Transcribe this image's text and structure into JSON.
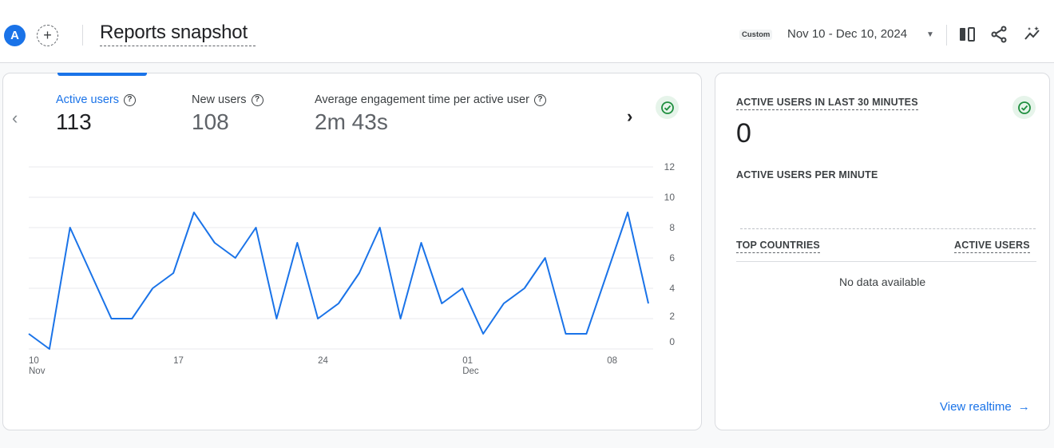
{
  "header": {
    "avatar_letter": "A",
    "add_symbol": "+",
    "title": "Reports snapshot",
    "date_chip": "Custom",
    "date_range": "Nov 10 - Dec 10, 2024",
    "date_caret": "▼",
    "icons": [
      "compare-icon",
      "share-icon",
      "insights-icon"
    ]
  },
  "metrics": [
    {
      "label": "Active users",
      "value": "113",
      "active": true
    },
    {
      "label": "New users",
      "value": "108",
      "active": false
    },
    {
      "label": "Average engagement time per active user",
      "value": "2m 43s",
      "active": false
    }
  ],
  "help_symbol": "?",
  "nav": {
    "prev": "‹",
    "next": "›"
  },
  "chart_data": {
    "type": "line",
    "title": "",
    "x": [
      "Nov 10",
      "Nov 11",
      "Nov 12",
      "Nov 13",
      "Nov 14",
      "Nov 15",
      "Nov 16",
      "Nov 17",
      "Nov 18",
      "Nov 19",
      "Nov 20",
      "Nov 21",
      "Nov 22",
      "Nov 23",
      "Nov 24",
      "Nov 25",
      "Nov 26",
      "Nov 27",
      "Nov 28",
      "Nov 29",
      "Nov 30",
      "Dec 01",
      "Dec 02",
      "Dec 03",
      "Dec 04",
      "Dec 05",
      "Dec 06",
      "Dec 07",
      "Dec 08",
      "Dec 09",
      "Dec 10"
    ],
    "series": [
      {
        "name": "Active users",
        "values": [
          1,
          0,
          8,
          5,
          2,
          2,
          4,
          5,
          9,
          7,
          6,
          8,
          2,
          7,
          2,
          3,
          5,
          8,
          2,
          7,
          3,
          4,
          1,
          3,
          4,
          6,
          1,
          1,
          5,
          9,
          3
        ]
      }
    ],
    "x_ticks": [
      {
        "day": "10",
        "month": "Nov"
      },
      {
        "day": "17",
        "month": ""
      },
      {
        "day": "24",
        "month": ""
      },
      {
        "day": "01",
        "month": "Dec"
      },
      {
        "day": "08",
        "month": ""
      }
    ],
    "y_ticks": [
      "0",
      "2",
      "4",
      "6",
      "8",
      "10",
      "12"
    ],
    "ylim": [
      0,
      12
    ],
    "grid": true,
    "color": "#1a73e8"
  },
  "realtime": {
    "title": "ACTIVE USERS IN LAST 30 MINUTES",
    "value": "0",
    "per_minute_label": "ACTIVE USERS PER MINUTE",
    "col_countries": "TOP COUNTRIES",
    "col_users": "ACTIVE USERS",
    "no_data": "No data available",
    "view_link": "View realtime",
    "arrow": "→"
  },
  "colors": {
    "accent": "#1a73e8",
    "success": "#1e8e3e",
    "success_bg": "#e6f4ea"
  }
}
